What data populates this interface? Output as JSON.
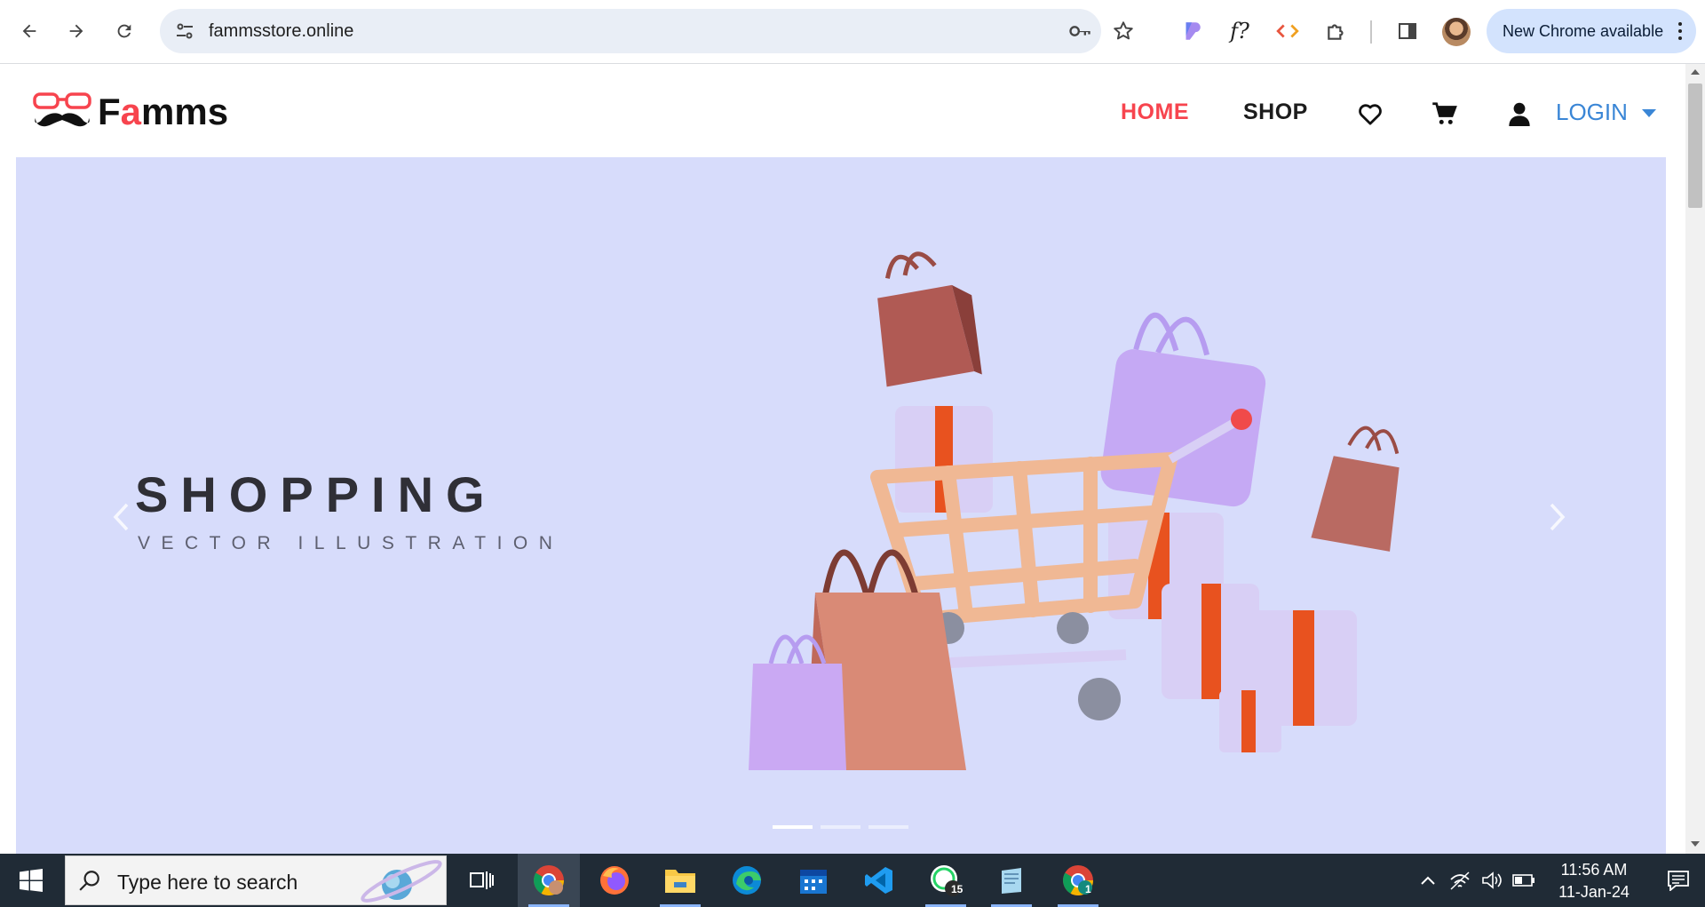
{
  "browser": {
    "url": "fammsstore.online",
    "update_button_label": "New Chrome available",
    "extensions": [
      "gemini-ext-icon",
      "formula-ext-icon",
      "code-ext-icon",
      "puzzle-icon"
    ]
  },
  "site": {
    "logo_prefix": "F",
    "logo_accent": "a",
    "logo_suffix": "mms",
    "nav": {
      "home": "HOME",
      "shop": "SHOP",
      "login": "LOGIN"
    },
    "colors": {
      "accent": "#f7444e",
      "login": "#3a86d6",
      "hero_bg": "#d7dcfb"
    }
  },
  "hero": {
    "title": "SHOPPING",
    "subtitle": "VECTOR ILLUSTRATION",
    "slides": 3,
    "active_slide": 1
  },
  "taskbar": {
    "search_placeholder": "Type here to search",
    "time": "11:56 AM",
    "date": "11-Jan-24",
    "whatsapp_badge": "15",
    "chrome2_badge": "1"
  }
}
